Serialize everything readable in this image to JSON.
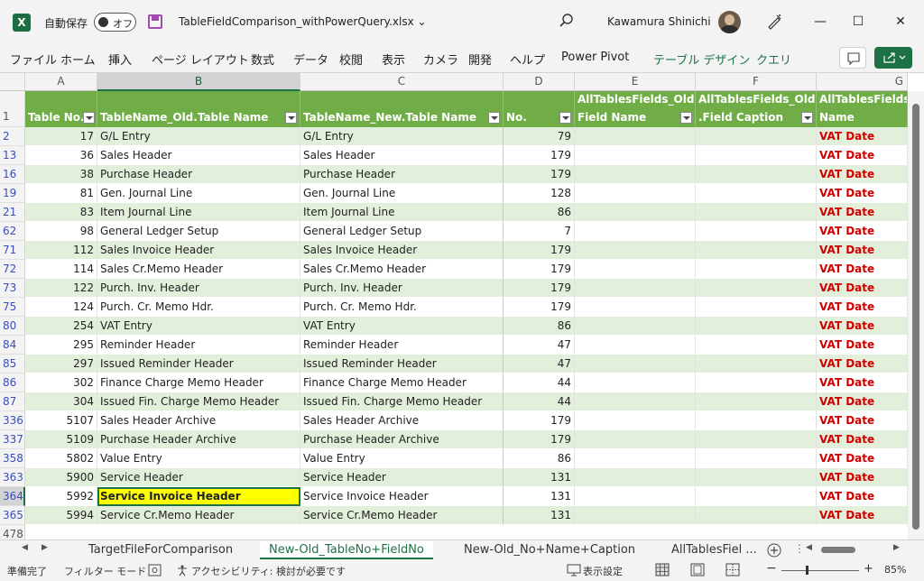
{
  "titlebar": {
    "app_logo": "X",
    "autosave_label": "自動保存",
    "toggle_text": "オフ",
    "doc_title": "TableFieldComparison_withPowerQuery.xlsx ⌄",
    "user_name": "Kawamura Shinichi",
    "minimize": "—",
    "restore": "☐",
    "close": "✕"
  },
  "ribbon": {
    "tabs": [
      "ファイル",
      "ホーム",
      "挿入",
      "ページ レイアウト",
      "数式",
      "データ",
      "校閲",
      "表示",
      "カメラ",
      "開発",
      "ヘルプ",
      "Power Pivot",
      "テーブル デザイン",
      "クエリ"
    ]
  },
  "columns": {
    "letters": [
      "A",
      "B",
      "C",
      "D",
      "E",
      "F",
      "G"
    ]
  },
  "headers": {
    "a": {
      "l1": "",
      "l2": "Table No."
    },
    "b": {
      "l1": "",
      "l2": "TableName_Old.Table Name"
    },
    "c": {
      "l1": "",
      "l2": "TableName_New.Table Name"
    },
    "d": {
      "l1": "",
      "l2": "No."
    },
    "e": {
      "l1": "AllTablesFields_Old.",
      "l2": "Field Name"
    },
    "f": {
      "l1": "AllTablesFields_Old",
      "l2": ".Field Caption"
    },
    "g": {
      "l1": "AllTablesFields_",
      "l2": "Name"
    }
  },
  "header_row_num": "1",
  "rows": [
    {
      "n": "2",
      "a": "17",
      "b": "G/L Entry",
      "c": "G/L Entry",
      "d": "79",
      "g": "VAT Date"
    },
    {
      "n": "13",
      "a": "36",
      "b": "Sales Header",
      "c": "Sales Header",
      "d": "179",
      "g": "VAT Date"
    },
    {
      "n": "16",
      "a": "38",
      "b": "Purchase Header",
      "c": "Purchase Header",
      "d": "179",
      "g": "VAT Date"
    },
    {
      "n": "19",
      "a": "81",
      "b": "Gen. Journal Line",
      "c": "Gen. Journal Line",
      "d": "128",
      "g": "VAT Date"
    },
    {
      "n": "21",
      "a": "83",
      "b": "Item Journal Line",
      "c": "Item Journal Line",
      "d": "86",
      "g": "VAT Date"
    },
    {
      "n": "62",
      "a": "98",
      "b": "General Ledger Setup",
      "c": "General Ledger Setup",
      "d": "7",
      "g": "VAT Date"
    },
    {
      "n": "71",
      "a": "112",
      "b": "Sales Invoice Header",
      "c": "Sales Invoice Header",
      "d": "179",
      "g": "VAT Date"
    },
    {
      "n": "72",
      "a": "114",
      "b": "Sales Cr.Memo Header",
      "c": "Sales Cr.Memo Header",
      "d": "179",
      "g": "VAT Date"
    },
    {
      "n": "73",
      "a": "122",
      "b": "Purch. Inv. Header",
      "c": "Purch. Inv. Header",
      "d": "179",
      "g": "VAT Date"
    },
    {
      "n": "75",
      "a": "124",
      "b": "Purch. Cr. Memo Hdr.",
      "c": "Purch. Cr. Memo Hdr.",
      "d": "179",
      "g": "VAT Date"
    },
    {
      "n": "80",
      "a": "254",
      "b": "VAT Entry",
      "c": "VAT Entry",
      "d": "86",
      "g": "VAT Date"
    },
    {
      "n": "84",
      "a": "295",
      "b": "Reminder Header",
      "c": "Reminder Header",
      "d": "47",
      "g": "VAT Date"
    },
    {
      "n": "85",
      "a": "297",
      "b": "Issued Reminder Header",
      "c": "Issued Reminder Header",
      "d": "47",
      "g": "VAT Date"
    },
    {
      "n": "86",
      "a": "302",
      "b": "Finance Charge Memo Header",
      "c": "Finance Charge Memo Header",
      "d": "44",
      "g": "VAT Date"
    },
    {
      "n": "87",
      "a": "304",
      "b": "Issued Fin. Charge Memo Header",
      "c": "Issued Fin. Charge Memo Header",
      "d": "44",
      "g": "VAT Date"
    },
    {
      "n": "336",
      "a": "5107",
      "b": "Sales Header Archive",
      "c": "Sales Header Archive",
      "d": "179",
      "g": "VAT Date"
    },
    {
      "n": "337",
      "a": "5109",
      "b": "Purchase Header Archive",
      "c": "Purchase Header Archive",
      "d": "179",
      "g": "VAT Date"
    },
    {
      "n": "358",
      "a": "5802",
      "b": "Value Entry",
      "c": "Value Entry",
      "d": "86",
      "g": "VAT Date"
    },
    {
      "n": "363",
      "a": "5900",
      "b": "Service Header",
      "c": "Service Header",
      "d": "131",
      "g": "VAT Date"
    },
    {
      "n": "364",
      "a": "5992",
      "b": "Service Invoice Header",
      "c": "Service Invoice Header",
      "d": "131",
      "g": "VAT Date"
    },
    {
      "n": "365",
      "a": "5994",
      "b": "Service Cr.Memo Header",
      "c": "Service Cr.Memo Header",
      "d": "131",
      "g": "VAT Date"
    }
  ],
  "empty_row_num": "478",
  "selected_row_num": "364",
  "sheets": {
    "tabs": [
      "TargetFileForComparison",
      "New-Old_TableNo+FieldNo",
      "New-Old_No+Name+Caption",
      "AllTablesFiel ..."
    ],
    "active": "New-Old_TableNo+FieldNo"
  },
  "status": {
    "ready": "準備完了",
    "filter_mode": "フィルター モード",
    "accessibility": "アクセシビリティ: 検討が必要です",
    "display_settings": "表示設定",
    "zoom": "85%"
  },
  "colors": {
    "header_green": "#70ad47",
    "band_green": "#e2efda",
    "vat_red": "#d00000",
    "selection_yellow": "#ffff00",
    "excel_green": "#1e7145"
  },
  "icons": [
    "excel-logo-icon",
    "save-icon",
    "search-icon",
    "pen-icon",
    "comment-icon",
    "share-icon",
    "filter-icon",
    "sheet-add-icon",
    "normal-view-icon",
    "page-layout-icon",
    "page-break-icon"
  ]
}
